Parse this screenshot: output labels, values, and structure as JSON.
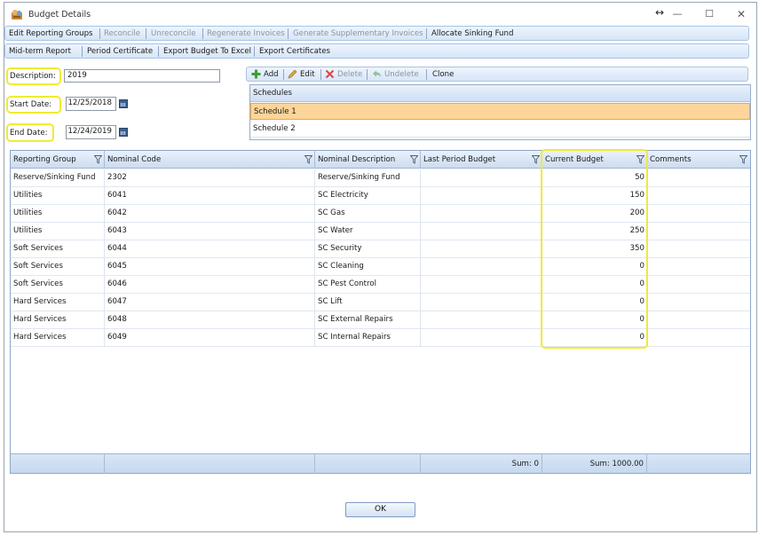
{
  "window": {
    "title": "Budget Details",
    "resize_glyph": "↔",
    "minimize_glyph": "—",
    "maximize_glyph": "☐",
    "close_glyph": "✕"
  },
  "toolbar1": {
    "edit_reporting_groups": "Edit Reporting Groups",
    "reconcile": "Reconcile",
    "unreconcile": "Unreconcile",
    "regenerate_invoices": "Regenerate Invoices",
    "generate_supplementary_invoices": "Generate Supplementary Invoices",
    "allocate_sinking_fund": "Allocate Sinking Fund"
  },
  "toolbar2": {
    "mid_term_report": "Mid-term Report",
    "period_certificate": "Period Certificate",
    "export_budget_to_excel": "Export Budget To Excel",
    "export_certificates": "Export Certificates"
  },
  "form": {
    "description_label": "Description:",
    "description_value": "2019",
    "start_date_label": "Start Date:",
    "start_date_value": "12/25/2018",
    "end_date_label": "End Date:",
    "end_date_value": "12/24/2019"
  },
  "schedule_toolbar": {
    "add": "Add",
    "edit": "Edit",
    "delete": "Delete",
    "undelete": "Undelete",
    "clone": "Clone"
  },
  "schedules": {
    "header": "Schedules",
    "items": [
      "Schedule 1",
      "Schedule 2"
    ],
    "selected_index": 0
  },
  "grid": {
    "columns": [
      "Reporting Group",
      "Nominal Code",
      "Nominal Description",
      "Last Period Budget",
      "Current Budget",
      "Comments"
    ],
    "rows": [
      [
        "Reserve/Sinking Fund",
        "2302",
        "Reserve/Sinking Fund",
        "",
        "50",
        ""
      ],
      [
        "Utilities",
        "6041",
        "SC Electricity",
        "",
        "150",
        ""
      ],
      [
        "Utilities",
        "6042",
        "SC Gas",
        "",
        "200",
        ""
      ],
      [
        "Utilities",
        "6043",
        "SC Water",
        "",
        "250",
        ""
      ],
      [
        "Soft Services",
        "6044",
        "SC Security",
        "",
        "350",
        ""
      ],
      [
        "Soft Services",
        "6045",
        "SC Cleaning",
        "",
        "0",
        ""
      ],
      [
        "Soft Services",
        "6046",
        "SC Pest Control",
        "",
        "0",
        ""
      ],
      [
        "Hard Services",
        "6047",
        "SC Lift",
        "",
        "0",
        ""
      ],
      [
        "Hard Services",
        "6048",
        "SC External Repairs",
        "",
        "0",
        ""
      ],
      [
        "Hard Services",
        "6049",
        "SC Internal Repairs",
        "",
        "0",
        ""
      ]
    ],
    "footer": {
      "last_period_sum": "Sum: 0",
      "current_budget_sum": "Sum: 1000.00"
    }
  },
  "ok_label": "OK",
  "colors": {
    "highlight": "#f2ea33",
    "selected_row": "#fdd49a",
    "toolbar_bg": "#d6e6f8"
  }
}
